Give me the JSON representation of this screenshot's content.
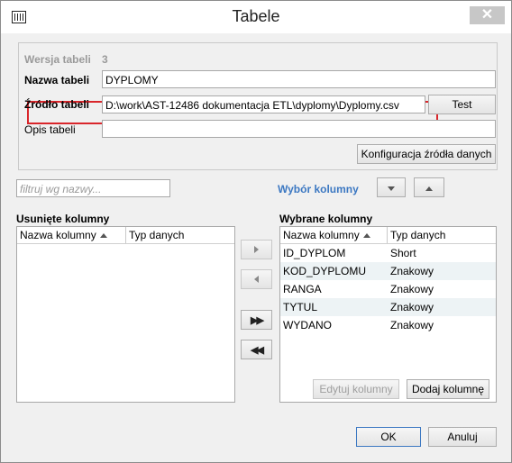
{
  "window": {
    "title": "Tabele",
    "close_label": "✕"
  },
  "table_info": {
    "version_label": "Wersja tabeli",
    "version_value": "3",
    "name_label": "Nazwa tabeli",
    "name_value": "DYPLOMY",
    "source_label": "Źródło tabeli",
    "source_value": "D:\\work\\AST-12486 dokumentacja ETL\\dyplomy\\Dyplomy.csv",
    "test_button": "Test",
    "description_label": "Opis tabeli",
    "description_value": "",
    "config_button": "Konfiguracja źródła danych"
  },
  "filter": {
    "placeholder": "filtruj wg nazwy..."
  },
  "column_selection_label": "Wybór kolumny",
  "removed_columns": {
    "title": "Usunięte kolumny",
    "headers": [
      "Nazwa kolumny",
      "Typ danych"
    ],
    "rows": []
  },
  "selected_columns": {
    "title": "Wybrane kolumny",
    "headers": [
      "Nazwa kolumny",
      "Typ danych"
    ],
    "rows": [
      {
        "name": "ID_DYPLOM",
        "type": "Short"
      },
      {
        "name": "KOD_DYPLOMU",
        "type": "Znakowy"
      },
      {
        "name": "RANGA",
        "type": "Znakowy"
      },
      {
        "name": "TYTUL",
        "type": "Znakowy"
      },
      {
        "name": "WYDANO",
        "type": "Znakowy"
      }
    ]
  },
  "buttons": {
    "edit_column": "Edytuj kolumny",
    "add_column": "Dodaj kolumnę",
    "ok": "OK",
    "cancel": "Anuluj"
  },
  "colors": {
    "highlight": "#d9262b",
    "link": "#3c78c2",
    "alt_row": "#edf3f5"
  }
}
